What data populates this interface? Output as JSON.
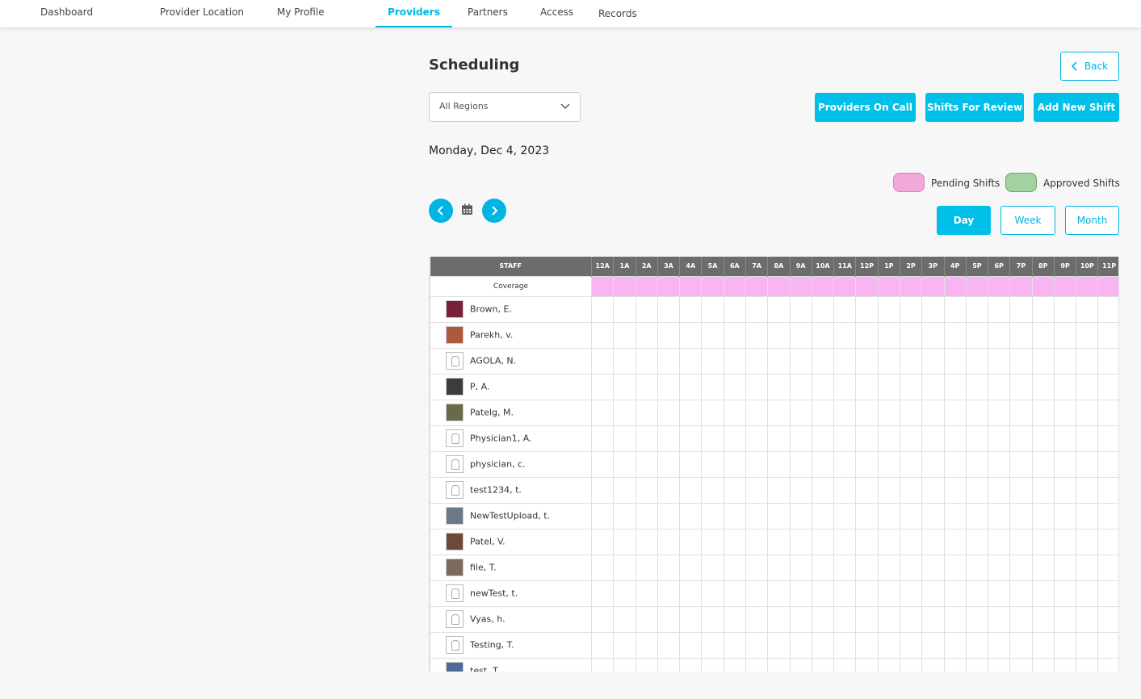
{
  "nav": {
    "items": [
      {
        "label": "Dashboard",
        "active": false
      },
      {
        "label": "Provider Location",
        "active": false
      },
      {
        "label": "My Profile",
        "active": false
      },
      {
        "label": "Providers",
        "active": true
      },
      {
        "label": "Partners",
        "active": false
      },
      {
        "label": "Access",
        "active": false
      },
      {
        "label": "Records",
        "active": false
      }
    ]
  },
  "page": {
    "title": "Scheduling",
    "back_label": "Back",
    "region_select": {
      "value": "All Regions"
    },
    "buttons": {
      "providers_on_call": "Providers On Call",
      "shifts_for_review": "Shifts For Review",
      "add_new_shift": "Add New Shift"
    },
    "date": "Monday, Dec 4, 2023",
    "legend": {
      "pending": {
        "label": "Pending Shifts",
        "color": "#f0a9d9"
      },
      "approved": {
        "label": "Approved Shifts",
        "color": "#a3d3a0"
      }
    },
    "views": {
      "day": "Day",
      "week": "Week",
      "month": "Month",
      "active": "day"
    }
  },
  "schedule": {
    "staff_header": "STAFF",
    "coverage_label": "Coverage",
    "coverage_color": "#f9b4f3",
    "hours": [
      "12A",
      "1A",
      "2A",
      "3A",
      "4A",
      "5A",
      "6A",
      "7A",
      "8A",
      "9A",
      "10A",
      "11A",
      "12P",
      "1P",
      "2P",
      "3P",
      "4P",
      "5P",
      "6P",
      "7P",
      "8P",
      "9P",
      "10P",
      "11P"
    ],
    "staff": [
      {
        "name": "Brown, E.",
        "avatar": "photo",
        "color": "#7a1f3a"
      },
      {
        "name": "Parekh, v.",
        "avatar": "photo",
        "color": "#b0583a"
      },
      {
        "name": "AGOLA, N.",
        "avatar": "placeholder"
      },
      {
        "name": "P, A.",
        "avatar": "photo",
        "color": "#3c3c3c"
      },
      {
        "name": "Patelg, M.",
        "avatar": "photo",
        "color": "#6a6a4a"
      },
      {
        "name": "Physician1, A.",
        "avatar": "placeholder"
      },
      {
        "name": "physician, c.",
        "avatar": "placeholder"
      },
      {
        "name": "test1234, t.",
        "avatar": "placeholder"
      },
      {
        "name": "NewTestUpload, t.",
        "avatar": "photo",
        "color": "#6b7a86"
      },
      {
        "name": "Patel, V.",
        "avatar": "photo",
        "color": "#6b4a3a"
      },
      {
        "name": "file, T.",
        "avatar": "photo",
        "color": "#7a6a5a"
      },
      {
        "name": "newTest, t.",
        "avatar": "placeholder"
      },
      {
        "name": "Vyas, h.",
        "avatar": "placeholder"
      },
      {
        "name": "Testing, T.",
        "avatar": "placeholder"
      },
      {
        "name": "test, T.",
        "avatar": "photo",
        "color": "#4a6a9a"
      }
    ]
  }
}
